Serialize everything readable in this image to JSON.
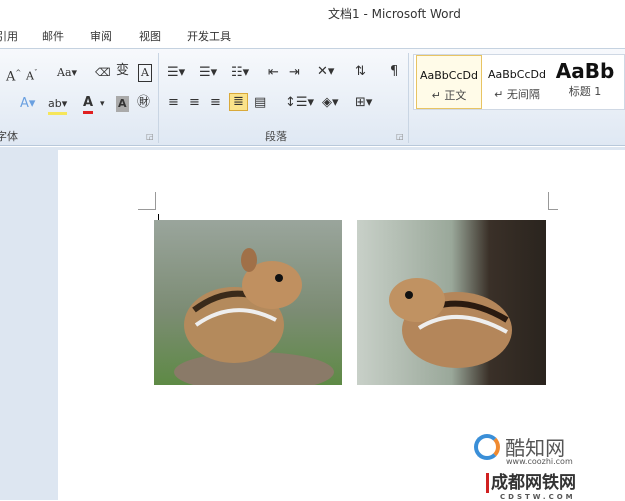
{
  "window": {
    "title": "文档1 - Microsoft Word"
  },
  "tabs": [
    "引用",
    "邮件",
    "审阅",
    "视图",
    "开发工具"
  ],
  "ribbon": {
    "groups": [
      {
        "label": "字体"
      },
      {
        "label": "段落"
      }
    ],
    "styles": [
      {
        "preview": "AaBbCcDd",
        "name": "↵ 正文",
        "selected": true
      },
      {
        "preview": "AaBbCcDd",
        "name": "↵ 无间隔"
      },
      {
        "preview": "AaBb",
        "name": "标题 1"
      }
    ]
  },
  "document": {
    "images": [
      {
        "alt": "chipmunk-on-rock"
      },
      {
        "alt": "chipmunk-on-tree"
      }
    ]
  },
  "watermarks": {
    "site1": "酷知网",
    "site1_url": "www.coozhi.com",
    "site2": "成都网铁网",
    "site2_url": "CDSTW.COM"
  },
  "colors": {
    "accent": "#e8c463",
    "ribbon": "#dfe8f3",
    "font_color_bar": "#e02020"
  }
}
